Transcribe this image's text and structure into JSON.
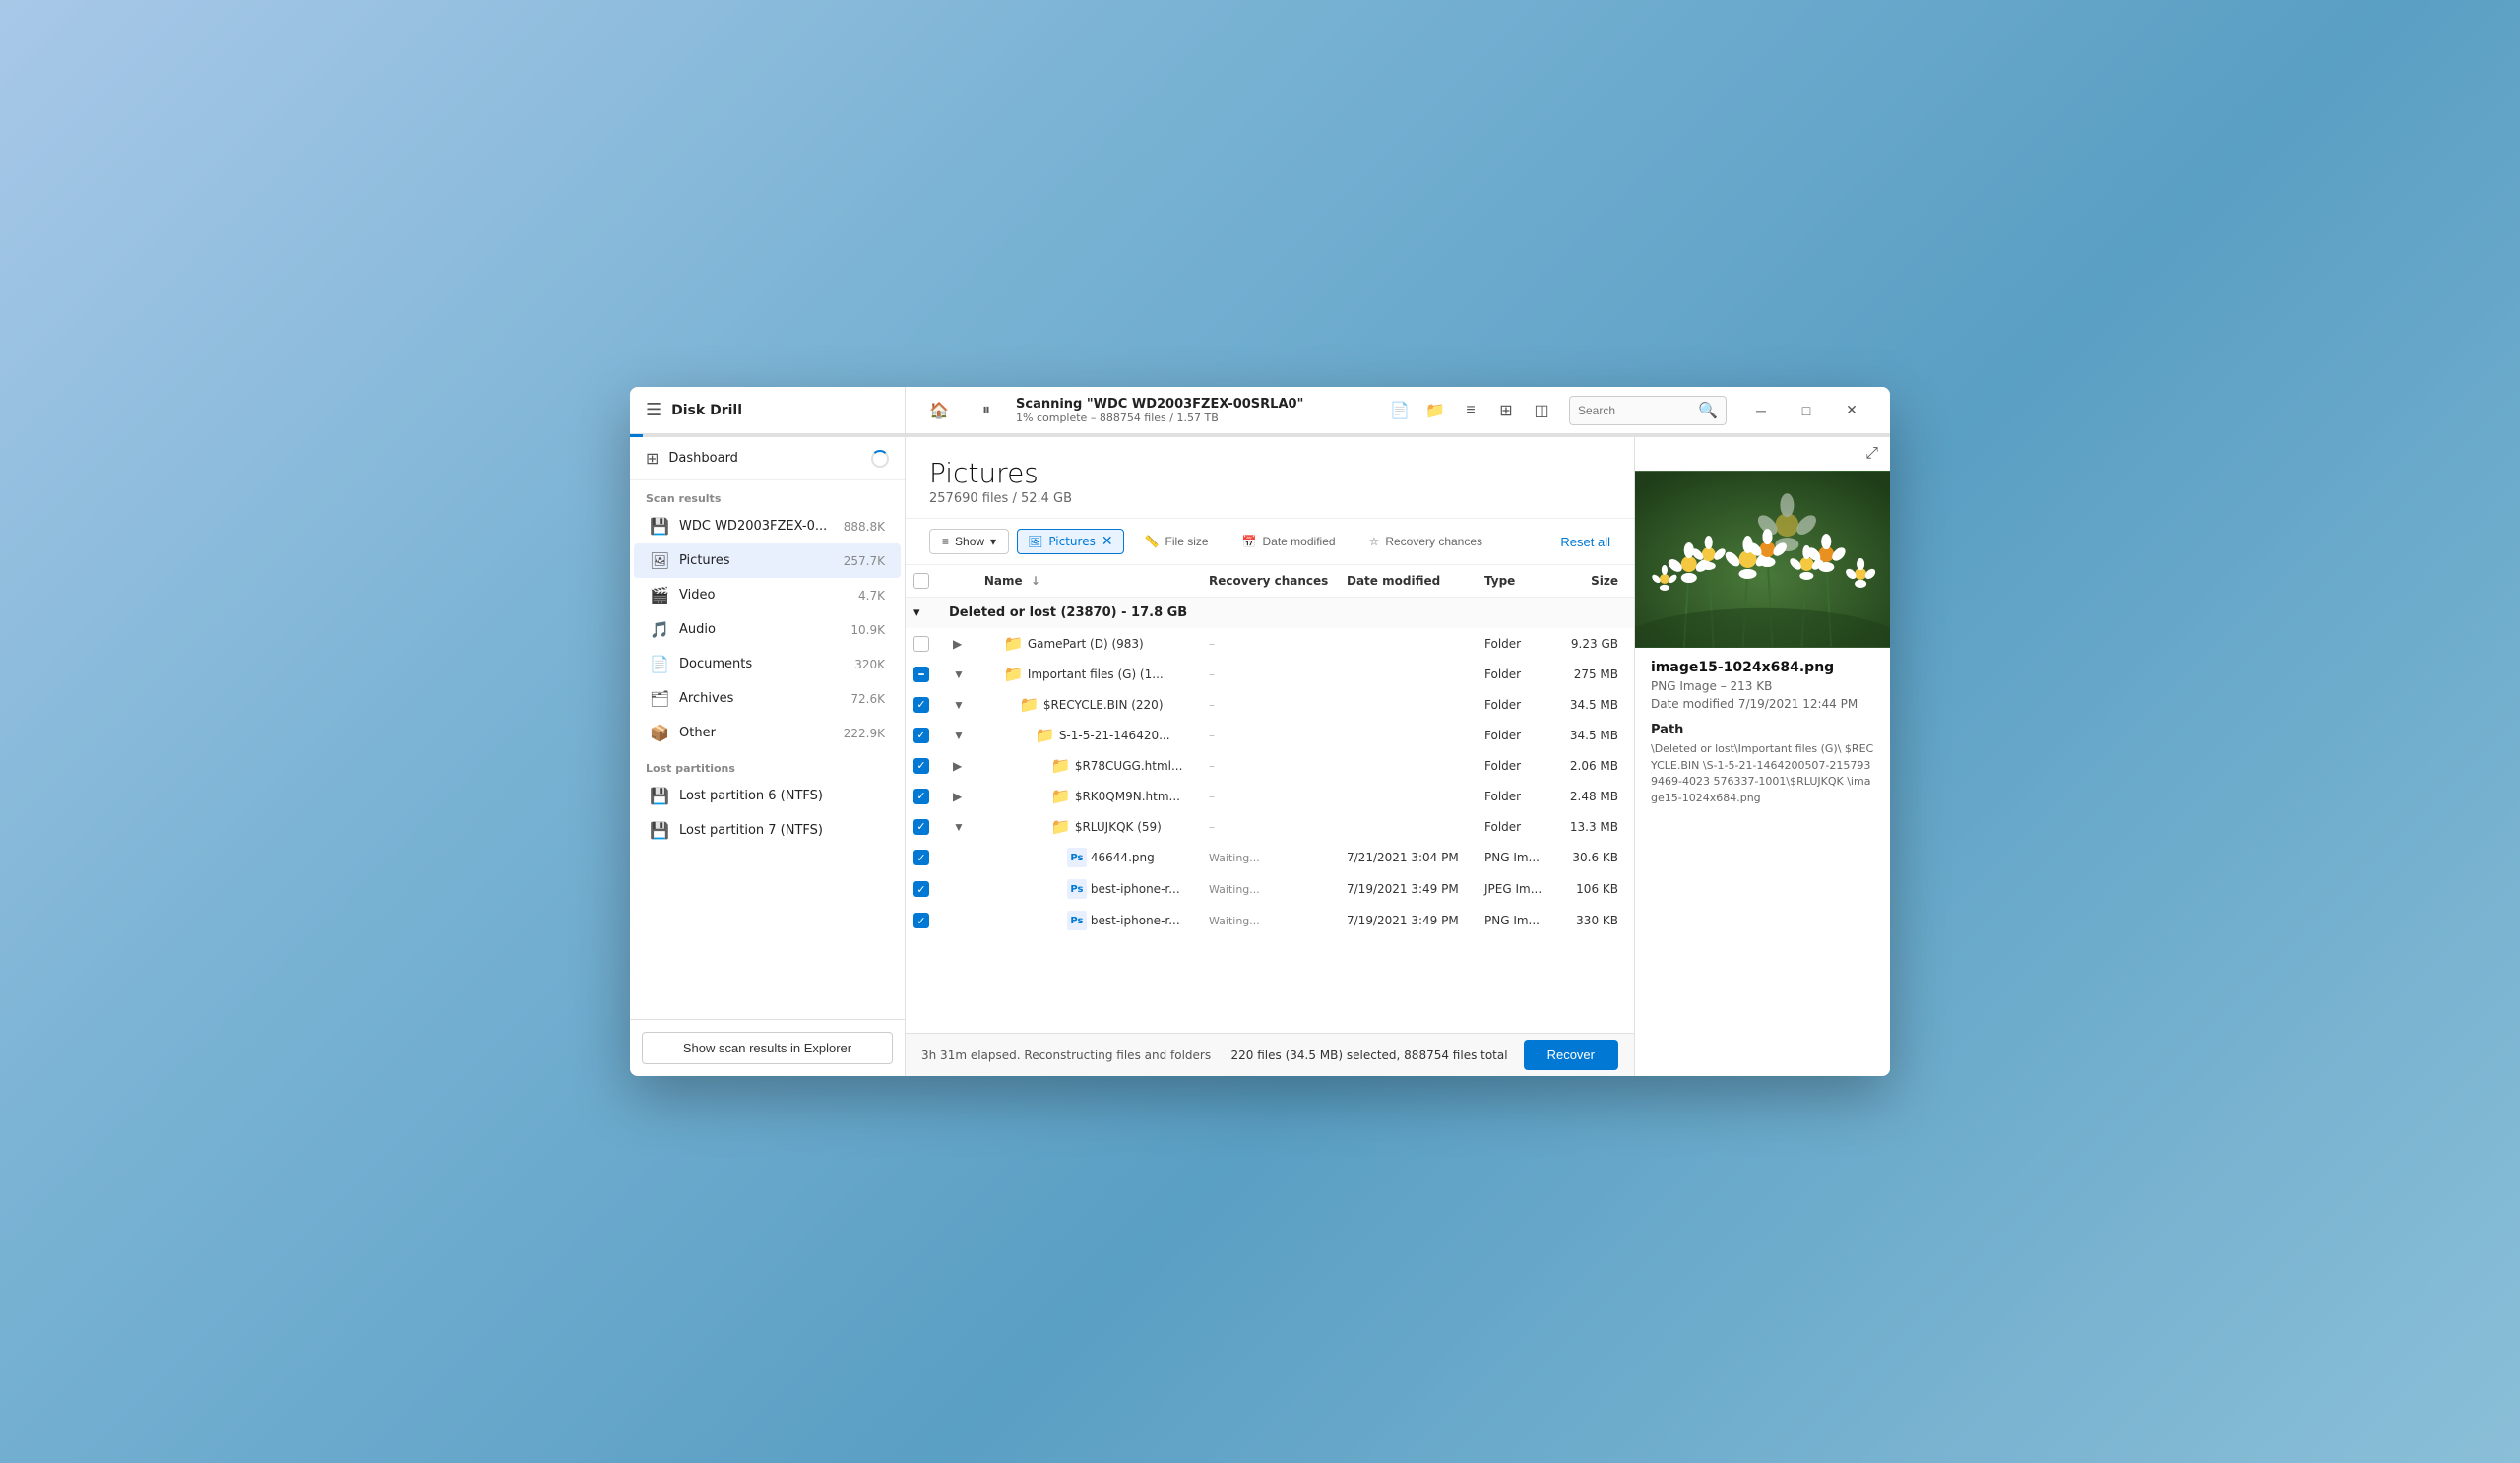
{
  "app": {
    "title": "Disk Drill",
    "logoIcon": "⊞"
  },
  "titleBar": {
    "scanTitle": "Scanning \"WDC WD2003FZEX-00SRLA0\"",
    "scanSubtitle": "1% complete – 888754 files / 1.57 TB",
    "searchPlaceholder": "Search",
    "progressPercent": 1
  },
  "windowControls": {
    "minimize": "─",
    "maximize": "□",
    "close": "✕"
  },
  "sidebar": {
    "dashboardLabel": "Dashboard",
    "scanResultsLabel": "Scan results",
    "items": [
      {
        "id": "wdc",
        "icon": "💾",
        "label": "WDC WD2003FZEX-0...",
        "count": "888.8K"
      },
      {
        "id": "pictures",
        "icon": "🖼",
        "label": "Pictures",
        "count": "257.7K",
        "active": true
      },
      {
        "id": "video",
        "icon": "🎬",
        "label": "Video",
        "count": "4.7K"
      },
      {
        "id": "audio",
        "icon": "🎵",
        "label": "Audio",
        "count": "10.9K"
      },
      {
        "id": "documents",
        "icon": "📄",
        "label": "Documents",
        "count": "320K"
      },
      {
        "id": "archives",
        "icon": "🗂",
        "label": "Archives",
        "count": "72.6K"
      },
      {
        "id": "other",
        "icon": "📦",
        "label": "Other",
        "count": "222.9K"
      }
    ],
    "lostPartitionsLabel": "Lost partitions",
    "lostPartitions": [
      {
        "id": "lp6",
        "icon": "💾",
        "label": "Lost partition 6 (NTFS)"
      },
      {
        "id": "lp7",
        "icon": "💾",
        "label": "Lost partition 7 (NTFS)"
      }
    ],
    "showExplorerBtn": "Show scan results in Explorer"
  },
  "main": {
    "title": "Pictures",
    "subtitle": "257690 files / 52.4 GB",
    "filters": {
      "showLabel": "Show",
      "picturesChipLabel": "Pictures",
      "fileSizeLabel": "File size",
      "dateModifiedLabel": "Date modified",
      "recoveryChancesLabel": "Recovery chances",
      "resetAllLabel": "Reset all"
    },
    "tableHeaders": {
      "name": "Name",
      "recoveryChances": "Recovery chances",
      "dateModified": "Date modified",
      "type": "Type",
      "size": "Size"
    },
    "groupRow": {
      "label": "Deleted or lost (23870) - 17.8 GB"
    },
    "rows": [
      {
        "id": "gamepart",
        "indent": 1,
        "expanded": false,
        "checked": false,
        "isFolder": true,
        "name": "GamePart (D) (983)",
        "recovery": "–",
        "dateModified": "",
        "type": "Folder",
        "size": "9.23 GB"
      },
      {
        "id": "important",
        "indent": 1,
        "expanded": true,
        "checked": "partial",
        "isFolder": true,
        "name": "Important files (G) (1...",
        "recovery": "–",
        "dateModified": "",
        "type": "Folder",
        "size": "275 MB"
      },
      {
        "id": "recycle",
        "indent": 2,
        "expanded": true,
        "checked": true,
        "isFolder": true,
        "name": "$RECYCLE.BIN (220)",
        "recovery": "–",
        "dateModified": "",
        "type": "Folder",
        "size": "34.5 MB"
      },
      {
        "id": "s1521",
        "indent": 3,
        "expanded": true,
        "checked": true,
        "isFolder": true,
        "name": "S-1-5-21-146420...",
        "recovery": "–",
        "dateModified": "",
        "type": "Folder",
        "size": "34.5 MB"
      },
      {
        "id": "r78cugg",
        "indent": 4,
        "expanded": false,
        "checked": true,
        "isFolder": true,
        "name": "$R78CUGG.html...",
        "recovery": "–",
        "dateModified": "",
        "type": "Folder",
        "size": "2.06 MB"
      },
      {
        "id": "rk0qm9n",
        "indent": 4,
        "expanded": false,
        "checked": true,
        "isFolder": true,
        "name": "$RK0QM9N.htm...",
        "recovery": "–",
        "dateModified": "",
        "type": "Folder",
        "size": "2.48 MB"
      },
      {
        "id": "rlujkqk",
        "indent": 4,
        "expanded": true,
        "checked": true,
        "isFolder": true,
        "name": "$RLUJKQK (59)",
        "recovery": "–",
        "dateModified": "",
        "type": "Folder",
        "size": "13.3 MB"
      },
      {
        "id": "46644",
        "indent": 5,
        "expanded": false,
        "checked": true,
        "isFolder": false,
        "fileType": "Ps",
        "name": "46644.png",
        "recovery": "Waiting...",
        "dateModified": "7/21/2021 3:04 PM",
        "type": "PNG Im...",
        "size": "30.6 KB"
      },
      {
        "id": "bestiphone1",
        "indent": 5,
        "expanded": false,
        "checked": true,
        "isFolder": false,
        "fileType": "Ps",
        "name": "best-iphone-r...",
        "recovery": "Waiting...",
        "dateModified": "7/19/2021 3:49 PM",
        "type": "JPEG Im...",
        "size": "106 KB"
      },
      {
        "id": "bestiphone2",
        "indent": 5,
        "expanded": false,
        "checked": true,
        "isFolder": false,
        "fileType": "Ps",
        "name": "best-iphone-r...",
        "recovery": "Waiting...",
        "dateModified": "7/19/2021 3:49 PM",
        "type": "PNG Im...",
        "size": "330 KB"
      }
    ]
  },
  "preview": {
    "openExternalLabel": "⤢",
    "filename": "image15-1024x684.png",
    "meta": "PNG Image – 213 KB",
    "dateModified": "Date modified 7/19/2021 12:44 PM",
    "pathLabel": "Path",
    "pathText": "\\Deleted or lost\\Important files (G)\\ $RECYCLE.BIN \\S-1-5-21-1464200507-2157939469-4023 576337-1001\\$RLUJKQK \\image15-1024x684.png"
  },
  "statusBar": {
    "statusText": "3h 31m elapsed. Reconstructing files and folders",
    "selectionText": "220 files (34.5 MB) selected, 888754 files total",
    "recoverLabel": "Recover"
  }
}
